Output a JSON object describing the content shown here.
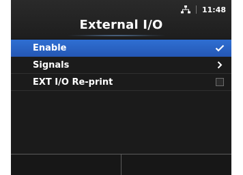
{
  "header": {
    "title": "External I/O",
    "time": "11:48",
    "status_icon": "network-icon"
  },
  "menu": {
    "items": [
      {
        "label": "Enable",
        "selected": true,
        "indicator": "checkmark-icon"
      },
      {
        "label": "Signals",
        "selected": false,
        "indicator": "chevron-right-icon"
      },
      {
        "label": "EXT I/O Re-print",
        "selected": false,
        "indicator": "checkbox-unchecked"
      }
    ]
  },
  "footer": {
    "left_key": "",
    "right_key": ""
  },
  "colors": {
    "background": "#1b1b1b",
    "selection": "#2f6fd3",
    "text": "#ffffff"
  }
}
